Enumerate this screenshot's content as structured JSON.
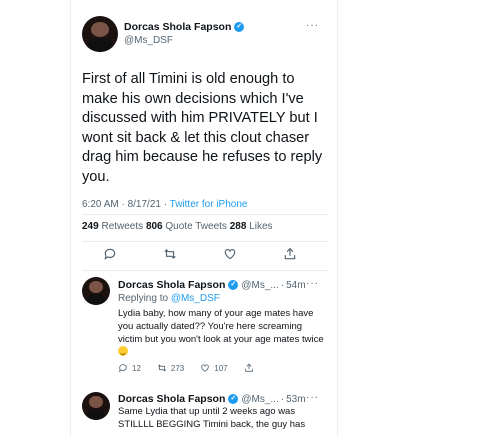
{
  "main_tweet": {
    "author_name": "Dorcas Shola Fapson",
    "verified_mark": "✓",
    "handle": "@Ms_DSF",
    "more": "···",
    "text": "First of all Timini is old enough to make his own decisions which I've discussed with him PRIVATELY but I wont sit back & let this clout chaser drag him because he refuses to reply you.",
    "timestamp": "6:20 AM · 8/17/21 · ",
    "source": "Twitter for iPhone",
    "retweets_count": "249",
    "retweets_label": " Retweets  ",
    "quote_count": "806",
    "quote_label": " Quote Tweets  ",
    "likes_count": "288",
    "likes_label": " Likes"
  },
  "actions": {
    "reply_icon": "comment-icon",
    "retweet_icon": "retweet-icon",
    "like_icon": "heart-icon",
    "share_icon": "share-icon"
  },
  "replies": [
    {
      "author_name": "Dorcas Shola Fapson",
      "verified_mark": "✓",
      "handle": "@Ms_...",
      "sep": "·",
      "time": "54m",
      "more": "···",
      "replying_prefix": "Replying to ",
      "replying_to": "@Ms_DSF",
      "text": "Lydia baby, how many of your age mates have you actually dated?? You're here screaming victim but you won't look at your age mates twice",
      "reply_count": "12",
      "retweet_count": "273",
      "like_count": "107"
    },
    {
      "author_name": "Dorcas Shola Fapson",
      "verified_mark": "✓",
      "handle": "@Ms_...",
      "sep": "·",
      "time": "53m",
      "more": "···",
      "text": "Same Lydia that up until 2 weeks ago was STILLLL BEGGING Timini back, the guy has"
    }
  ],
  "colors": {
    "accent": "#1d9bf0",
    "text": "#0f1419",
    "muted": "#536471"
  }
}
